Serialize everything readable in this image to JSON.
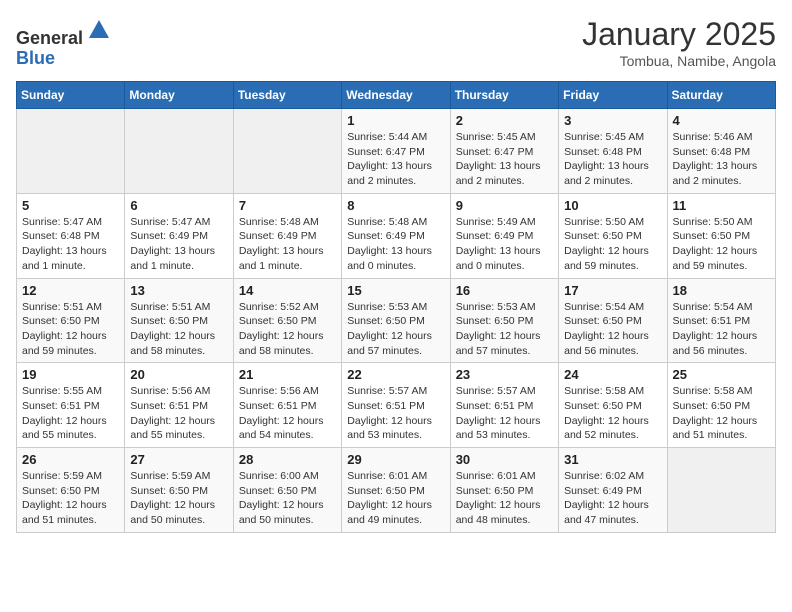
{
  "header": {
    "logo_line1": "General",
    "logo_line2": "Blue",
    "month": "January 2025",
    "location": "Tombua, Namibe, Angola"
  },
  "weekdays": [
    "Sunday",
    "Monday",
    "Tuesday",
    "Wednesday",
    "Thursday",
    "Friday",
    "Saturday"
  ],
  "weeks": [
    [
      {
        "day": "",
        "info": ""
      },
      {
        "day": "",
        "info": ""
      },
      {
        "day": "",
        "info": ""
      },
      {
        "day": "1",
        "info": "Sunrise: 5:44 AM\nSunset: 6:47 PM\nDaylight: 13 hours and 2 minutes."
      },
      {
        "day": "2",
        "info": "Sunrise: 5:45 AM\nSunset: 6:47 PM\nDaylight: 13 hours and 2 minutes."
      },
      {
        "day": "3",
        "info": "Sunrise: 5:45 AM\nSunset: 6:48 PM\nDaylight: 13 hours and 2 minutes."
      },
      {
        "day": "4",
        "info": "Sunrise: 5:46 AM\nSunset: 6:48 PM\nDaylight: 13 hours and 2 minutes."
      }
    ],
    [
      {
        "day": "5",
        "info": "Sunrise: 5:47 AM\nSunset: 6:48 PM\nDaylight: 13 hours and 1 minute."
      },
      {
        "day": "6",
        "info": "Sunrise: 5:47 AM\nSunset: 6:49 PM\nDaylight: 13 hours and 1 minute."
      },
      {
        "day": "7",
        "info": "Sunrise: 5:48 AM\nSunset: 6:49 PM\nDaylight: 13 hours and 1 minute."
      },
      {
        "day": "8",
        "info": "Sunrise: 5:48 AM\nSunset: 6:49 PM\nDaylight: 13 hours and 0 minutes."
      },
      {
        "day": "9",
        "info": "Sunrise: 5:49 AM\nSunset: 6:49 PM\nDaylight: 13 hours and 0 minutes."
      },
      {
        "day": "10",
        "info": "Sunrise: 5:50 AM\nSunset: 6:50 PM\nDaylight: 12 hours and 59 minutes."
      },
      {
        "day": "11",
        "info": "Sunrise: 5:50 AM\nSunset: 6:50 PM\nDaylight: 12 hours and 59 minutes."
      }
    ],
    [
      {
        "day": "12",
        "info": "Sunrise: 5:51 AM\nSunset: 6:50 PM\nDaylight: 12 hours and 59 minutes."
      },
      {
        "day": "13",
        "info": "Sunrise: 5:51 AM\nSunset: 6:50 PM\nDaylight: 12 hours and 58 minutes."
      },
      {
        "day": "14",
        "info": "Sunrise: 5:52 AM\nSunset: 6:50 PM\nDaylight: 12 hours and 58 minutes."
      },
      {
        "day": "15",
        "info": "Sunrise: 5:53 AM\nSunset: 6:50 PM\nDaylight: 12 hours and 57 minutes."
      },
      {
        "day": "16",
        "info": "Sunrise: 5:53 AM\nSunset: 6:50 PM\nDaylight: 12 hours and 57 minutes."
      },
      {
        "day": "17",
        "info": "Sunrise: 5:54 AM\nSunset: 6:50 PM\nDaylight: 12 hours and 56 minutes."
      },
      {
        "day": "18",
        "info": "Sunrise: 5:54 AM\nSunset: 6:51 PM\nDaylight: 12 hours and 56 minutes."
      }
    ],
    [
      {
        "day": "19",
        "info": "Sunrise: 5:55 AM\nSunset: 6:51 PM\nDaylight: 12 hours and 55 minutes."
      },
      {
        "day": "20",
        "info": "Sunrise: 5:56 AM\nSunset: 6:51 PM\nDaylight: 12 hours and 55 minutes."
      },
      {
        "day": "21",
        "info": "Sunrise: 5:56 AM\nSunset: 6:51 PM\nDaylight: 12 hours and 54 minutes."
      },
      {
        "day": "22",
        "info": "Sunrise: 5:57 AM\nSunset: 6:51 PM\nDaylight: 12 hours and 53 minutes."
      },
      {
        "day": "23",
        "info": "Sunrise: 5:57 AM\nSunset: 6:51 PM\nDaylight: 12 hours and 53 minutes."
      },
      {
        "day": "24",
        "info": "Sunrise: 5:58 AM\nSunset: 6:50 PM\nDaylight: 12 hours and 52 minutes."
      },
      {
        "day": "25",
        "info": "Sunrise: 5:58 AM\nSunset: 6:50 PM\nDaylight: 12 hours and 51 minutes."
      }
    ],
    [
      {
        "day": "26",
        "info": "Sunrise: 5:59 AM\nSunset: 6:50 PM\nDaylight: 12 hours and 51 minutes."
      },
      {
        "day": "27",
        "info": "Sunrise: 5:59 AM\nSunset: 6:50 PM\nDaylight: 12 hours and 50 minutes."
      },
      {
        "day": "28",
        "info": "Sunrise: 6:00 AM\nSunset: 6:50 PM\nDaylight: 12 hours and 50 minutes."
      },
      {
        "day": "29",
        "info": "Sunrise: 6:01 AM\nSunset: 6:50 PM\nDaylight: 12 hours and 49 minutes."
      },
      {
        "day": "30",
        "info": "Sunrise: 6:01 AM\nSunset: 6:50 PM\nDaylight: 12 hours and 48 minutes."
      },
      {
        "day": "31",
        "info": "Sunrise: 6:02 AM\nSunset: 6:49 PM\nDaylight: 12 hours and 47 minutes."
      },
      {
        "day": "",
        "info": ""
      }
    ]
  ]
}
